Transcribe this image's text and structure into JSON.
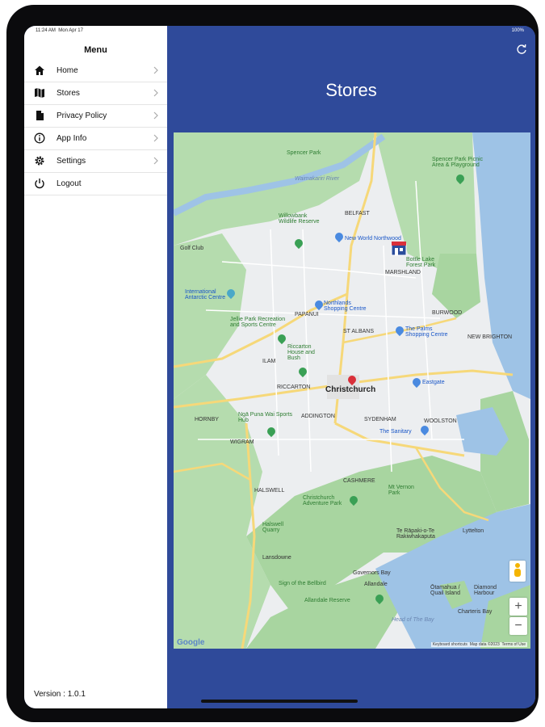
{
  "status_bar": {
    "time": "11:24 AM",
    "date": "Mon Apr 17",
    "battery": "100%"
  },
  "sidebar": {
    "title": "Menu",
    "items": [
      {
        "label": "Home",
        "icon": "home-icon"
      },
      {
        "label": "Stores",
        "icon": "map-icon"
      },
      {
        "label": "Privacy Policy",
        "icon": "document-icon"
      },
      {
        "label": "App Info",
        "icon": "info-icon"
      },
      {
        "label": "Settings",
        "icon": "gear-icon"
      },
      {
        "label": "Logout",
        "icon": "power-icon"
      }
    ],
    "version": "Version : 1.0.1"
  },
  "main": {
    "title": "Stores",
    "refresh_icon": "refresh-icon"
  },
  "map": {
    "places": {
      "christchurch": "Christchurch",
      "new_world": "New World Northwood",
      "northlands": "Northlands Shopping Centre",
      "palms": "The Palms Shopping Centre",
      "eastgate": "Eastgate",
      "sanitarium": "The Sanitary",
      "riccarton": "Riccarton House and Bush",
      "jellie": "Jellie Park Recreation and Sports Centre",
      "antarctic": "International Antarctic Centre",
      "willowbank": "Willowbank Wildlife Reserve",
      "spencer": "Spencer Park Picnic Area & Playground",
      "bottle_lake": "Bottle Lake Forest Park",
      "nga_puna": "Ngā Puna Wai Sports Hub",
      "adventure": "Christchurch Adventure Park",
      "mt_vernon": "Mt Vernon Park",
      "te_rapaki": "Te Rāpaki-o-Te Rakiwhakaputa",
      "lyttelton": "Lyttelton",
      "governors": "Governors Bay",
      "allandale": "Allandale",
      "allandale_reserve": "Allandale Reserve",
      "bellbird": "Sign of the Bellbird",
      "lansdowne": "Lansdowne",
      "halswell": "Halswell Quarry",
      "sydenham": "SYDENHAM",
      "addington": "ADDINGTON",
      "riccarton_area": "RICCARTON",
      "hornby": "HORNBY",
      "wigram": "WIGRAM",
      "marshland": "MARSHLAND",
      "burwood": "BURWOOD",
      "belfast": "BELFAST",
      "papanui": "PAPANUI",
      "st_albans": "ST ALBANS",
      "ilam": "ILAM",
      "woolston": "WOOLSTON",
      "cashmere": "CASHMERE",
      "halswell_area": "HALSWELL",
      "new_brighton": "NEW BRIGHTON",
      "quail_island": "Ōtamahua / Quail Island",
      "diamond_harbour": "Diamond Harbour",
      "charteris_bay": "Charteris Bay",
      "harbour": "Head of The Bay",
      "waimakariri": "Waimakariri River",
      "golf": "Golf Club",
      "kapopo": "Spencer Park"
    },
    "attribution": {
      "google": "Google",
      "shortcuts": "Keyboard shortcuts",
      "map_data": "Map data ©2023",
      "terms": "Terms of Use"
    },
    "zoom_in": "+",
    "zoom_out": "−"
  },
  "colors": {
    "header_blue": "#2f4a9a",
    "map_green": "#a8d5a0",
    "map_water": "#9ec3e6",
    "map_urban": "#eceef0",
    "road_yellow": "#f6d879"
  }
}
